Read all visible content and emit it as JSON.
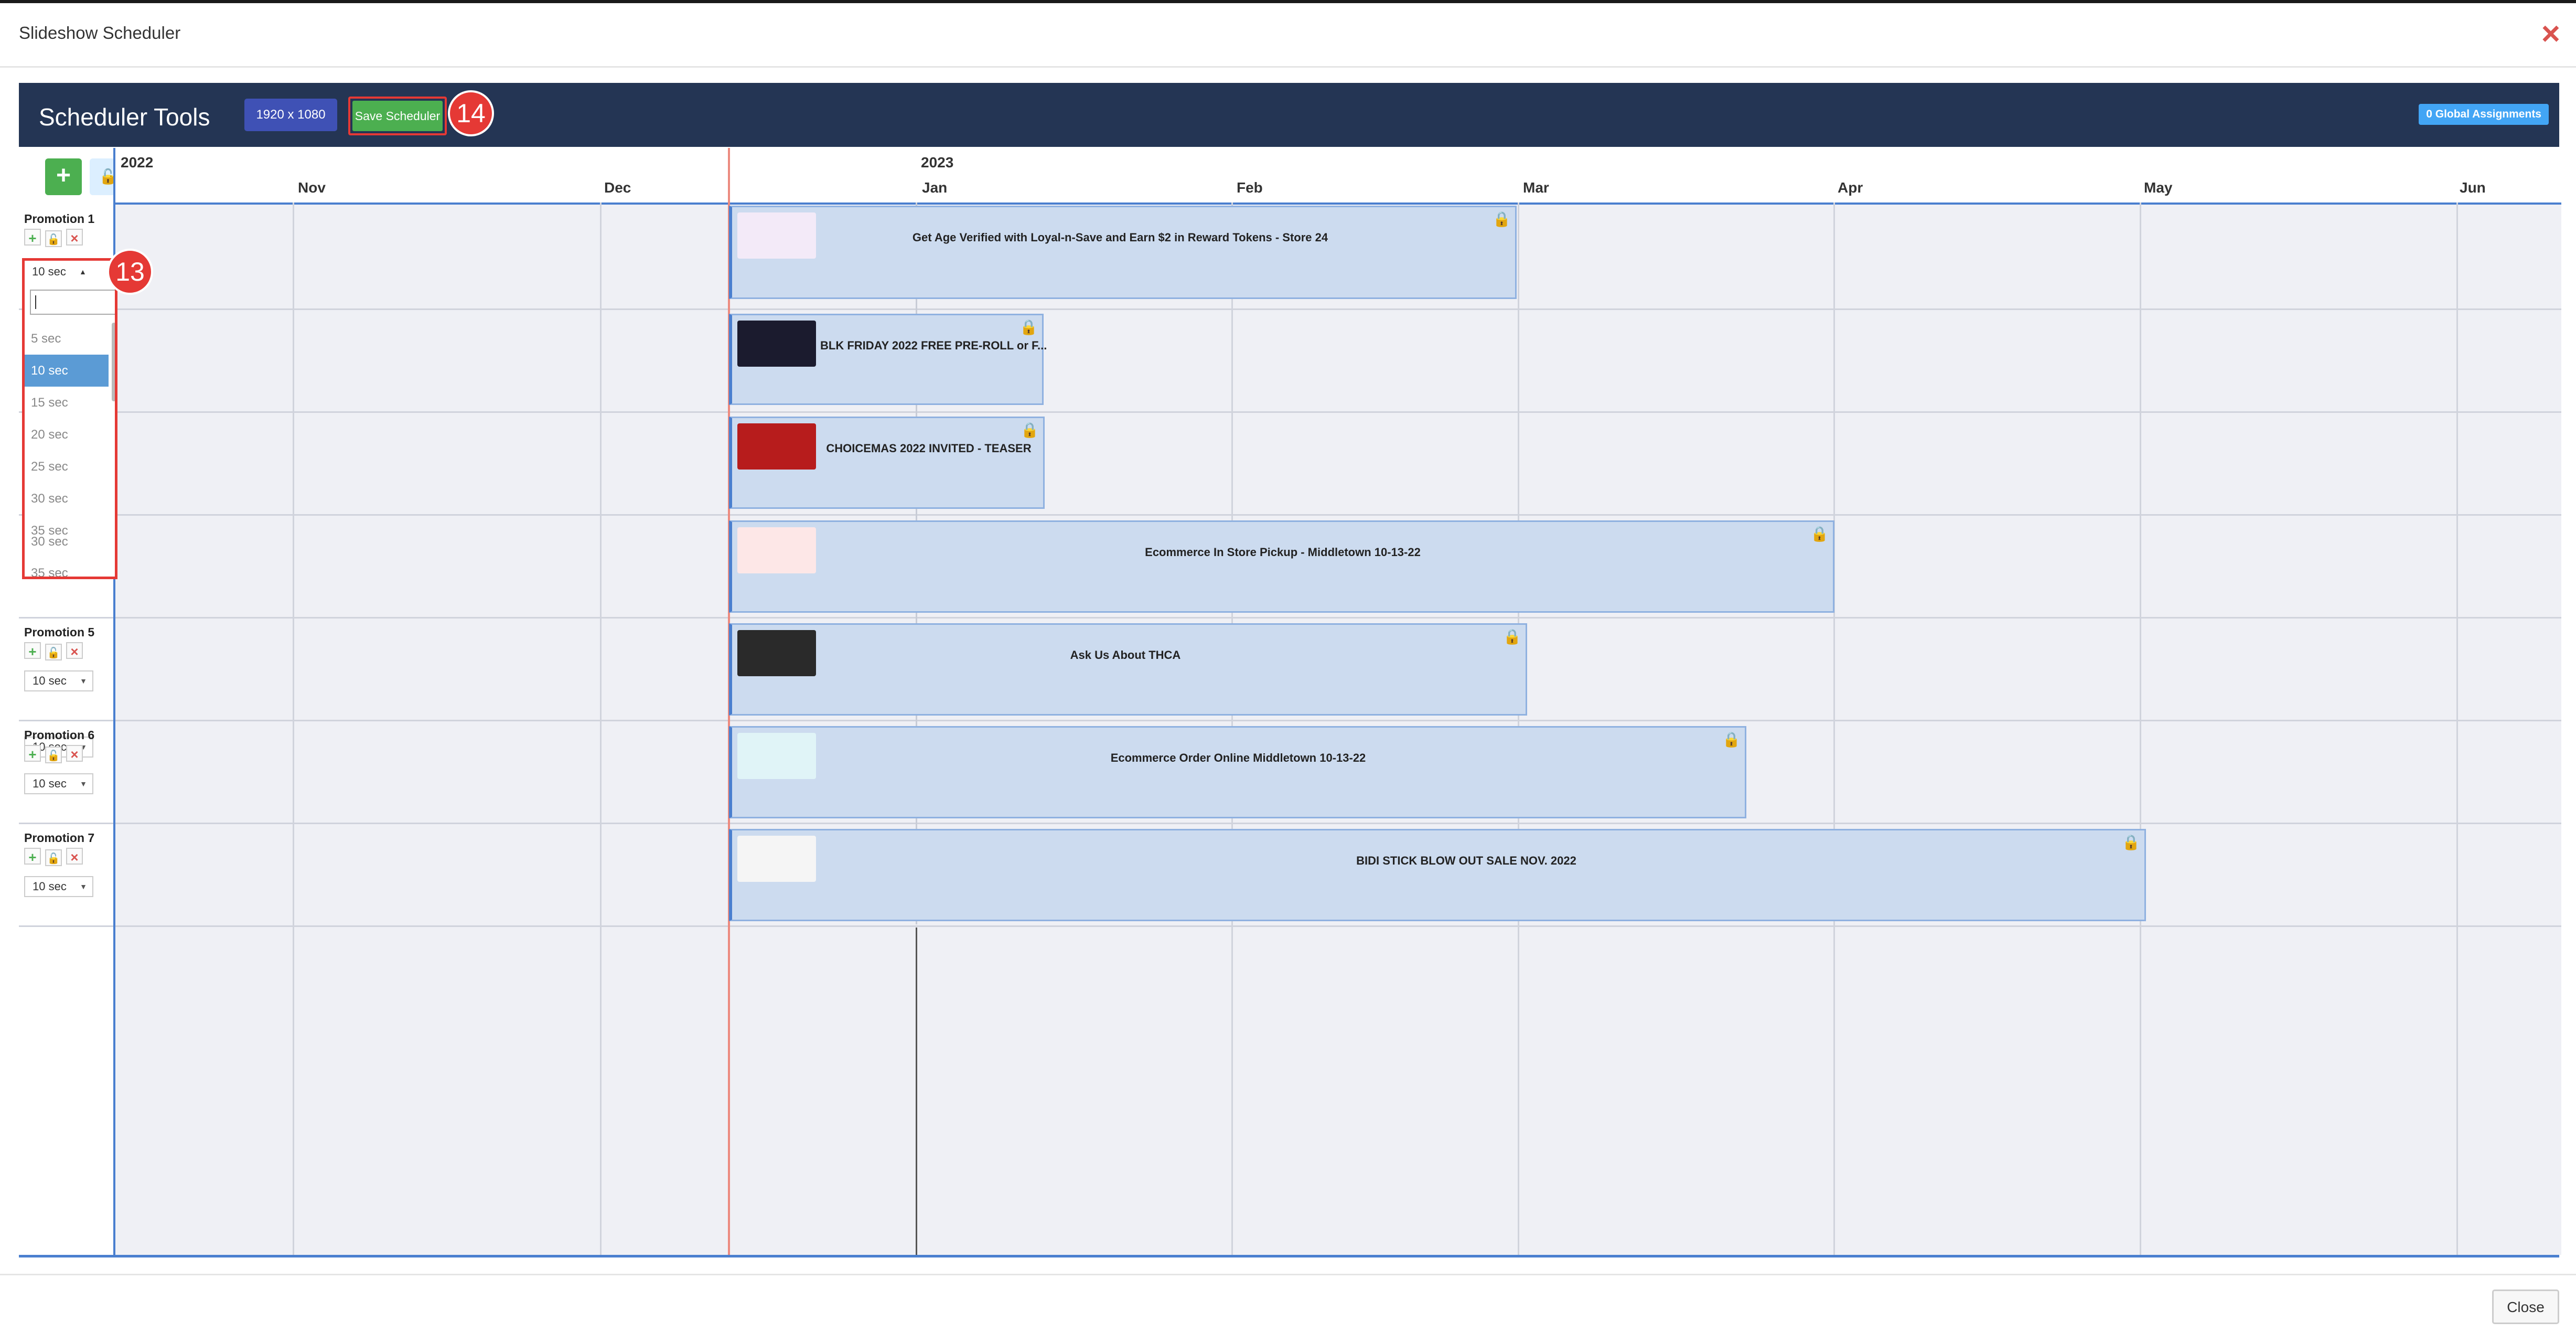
{
  "modal": {
    "title": "Slideshow Scheduler",
    "close_icon": "×",
    "close_button": "Close"
  },
  "toolbar": {
    "title": "Scheduler Tools",
    "resolution_label": "1920 x 1080",
    "save_label": "Save Scheduler",
    "global_assignments": "0 Global Assignments",
    "badge_save": "14"
  },
  "left": {
    "add_icon": "+",
    "lock_icon": "🔓"
  },
  "timeline": {
    "years": [
      "2022",
      "2023"
    ],
    "months": [
      "Nov",
      "Dec",
      "Jan",
      "Feb",
      "Mar",
      "Apr",
      "May",
      "Jun"
    ]
  },
  "promotions": [
    {
      "name": "Promotion 1",
      "duration": "10 sec"
    },
    {
      "name": "",
      "duration": ""
    },
    {
      "name": "",
      "duration": ""
    },
    {
      "name": "",
      "duration": "10 sec"
    },
    {
      "name": "Promotion 5",
      "duration": "10 sec"
    },
    {
      "name": "Promotion 6",
      "duration": "10 sec"
    },
    {
      "name": "Promotion 7",
      "duration": "10 sec"
    }
  ],
  "dropdown": {
    "badge": "13",
    "current": "10 sec",
    "options": [
      "5 sec",
      "10 sec",
      "15 sec",
      "20 sec",
      "25 sec",
      "30 sec",
      "35 sec"
    ],
    "selected_index": 1,
    "extra_a": "30 sec",
    "extra_b": "35 sec"
  },
  "events": [
    {
      "title": "Get Age Verified with Loyal-n-Save and Earn $2 in Reward Tokens - Store 24",
      "thumb_color": "#f3eaf8",
      "locked": true
    },
    {
      "title": "BLK FRIDAY 2022 FREE PRE-ROLL or F...",
      "thumb_color": "#1b1b2e",
      "locked": true
    },
    {
      "title": "CHOICEMAS 2022 INVITED - TEASER",
      "thumb_color": "#b71c1c",
      "locked": true
    },
    {
      "title": "Ecommerce In Store Pickup - Middletown 10-13-22",
      "thumb_color": "#fde7e7",
      "locked": true
    },
    {
      "title": "Ask Us About THCA",
      "thumb_color": "#2a2a2a",
      "locked": true
    },
    {
      "title": "Ecommerce Order Online Middletown 10-13-22",
      "thumb_color": "#e0f4f7",
      "locked": true
    },
    {
      "title": "BIDI STICK BLOW OUT SALE NOV. 2022",
      "thumb_color": "#f5f5f5",
      "locked": true
    }
  ]
}
